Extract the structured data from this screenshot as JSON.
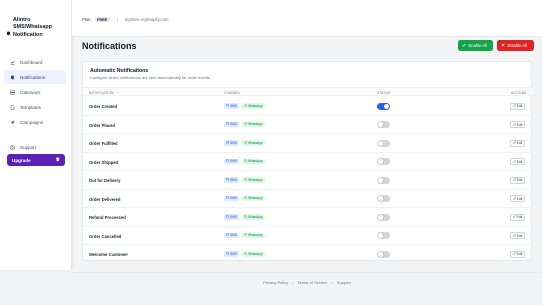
{
  "brand": {
    "line1": "Alintro",
    "line2": "SMS/Whatsapp",
    "line3": "Notification"
  },
  "sidebar": {
    "items": [
      {
        "label": "Dashboard",
        "icon": "chart-icon",
        "active": false
      },
      {
        "label": "Notifications",
        "icon": "bell-icon",
        "active": true
      },
      {
        "label": "Gateways",
        "icon": "server-icon",
        "active": false
      },
      {
        "label": "Templates",
        "icon": "document-icon",
        "active": false
      },
      {
        "label": "Campaigns",
        "icon": "send-icon",
        "active": false
      }
    ],
    "support": "Support",
    "upgrade": "Upgrade"
  },
  "topbar": {
    "plan_label": "Plan:",
    "plan_value": "FREE",
    "separator": "|",
    "domain": "mystore.myshopify.com"
  },
  "page": {
    "title": "Notifications",
    "enable_all": "Enable All",
    "disable_all": "Disable All"
  },
  "card": {
    "title": "Automatic Notifications",
    "description": "Configure which notifications are sent automatically for order events",
    "columns": {
      "notification": "NOTIFICATION",
      "channel": "CHANNEL",
      "status": "STATUS",
      "actions": "ACTIONS"
    },
    "rows": [
      {
        "name": "Order Created",
        "sms": "SMS",
        "wa": "WhatsApp",
        "enabled": true,
        "edit": "Edit"
      },
      {
        "name": "Order Placed",
        "sms": "SMS",
        "wa": "WhatsApp",
        "enabled": false,
        "edit": "Edit"
      },
      {
        "name": "Order Fulfilled",
        "sms": "SMS",
        "wa": "WhatsApp",
        "enabled": false,
        "edit": "Edit"
      },
      {
        "name": "Order Shipped",
        "sms": "SMS",
        "wa": "WhatsApp",
        "enabled": false,
        "edit": "Edit"
      },
      {
        "name": "Out for Delivery",
        "sms": "SMS",
        "wa": "WhatsApp",
        "enabled": false,
        "edit": "Edit"
      },
      {
        "name": "Order Delivered",
        "sms": "SMS",
        "wa": "WhatsApp",
        "enabled": false,
        "edit": "Edit"
      },
      {
        "name": "Refund Processed",
        "sms": "SMS",
        "wa": "WhatsApp",
        "enabled": false,
        "edit": "Edit"
      },
      {
        "name": "Order Cancelled",
        "sms": "SMS",
        "wa": "WhatsApp",
        "enabled": false,
        "edit": "Edit"
      },
      {
        "name": "Welcome Customer",
        "sms": "SMS",
        "wa": "WhatsApp",
        "enabled": false,
        "edit": "Edit"
      }
    ]
  },
  "footer": {
    "privacy": "Privacy Policy",
    "terms": "Terms of Service",
    "support": "Support",
    "dot": "•"
  },
  "colors": {
    "accent": "#2563eb",
    "enable": "#16a34a",
    "disable": "#dc2626",
    "upgrade": "#5b21b6"
  }
}
